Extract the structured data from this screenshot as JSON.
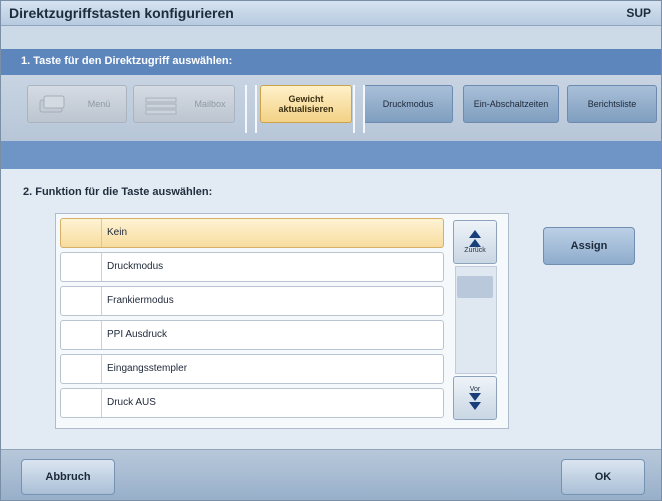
{
  "window": {
    "title": "Direktzugriffstasten konfigurieren",
    "user": "SUP"
  },
  "step1": {
    "heading": "1.  Taste für den Direktzugriff auswählen:",
    "tabs": [
      {
        "label": "Menü",
        "state": "disabled",
        "icon": "menu-card-icon"
      },
      {
        "label": "Mailbox",
        "state": "disabled",
        "icon": "mailbox-icon"
      },
      {
        "label": "Gewicht aktualisieren",
        "state": "selected"
      },
      {
        "label": "Druckmodus",
        "state": "normal"
      },
      {
        "label": "Ein-Abschaltzeiten",
        "state": "normal"
      },
      {
        "label": "Berichtsliste",
        "state": "normal"
      }
    ]
  },
  "step2": {
    "heading": "2.  Funktion für die Taste auswählen:",
    "items": [
      {
        "label": "Kein",
        "selected": true
      },
      {
        "label": "Druckmodus",
        "selected": false
      },
      {
        "label": "Frankiermodus",
        "selected": false
      },
      {
        "label": "PPI Ausdruck",
        "selected": false
      },
      {
        "label": "Eingangsstempler",
        "selected": false
      },
      {
        "label": "Druck AUS",
        "selected": false
      }
    ],
    "scroll_up_label": "Zurück",
    "scroll_down_label": "Vor",
    "assign_label": "Assign"
  },
  "footer": {
    "cancel_label": "Abbruch",
    "ok_label": "OK"
  },
  "colors": {
    "accent_blue": "#5d86bd",
    "selected_amber": "#f3d186"
  }
}
